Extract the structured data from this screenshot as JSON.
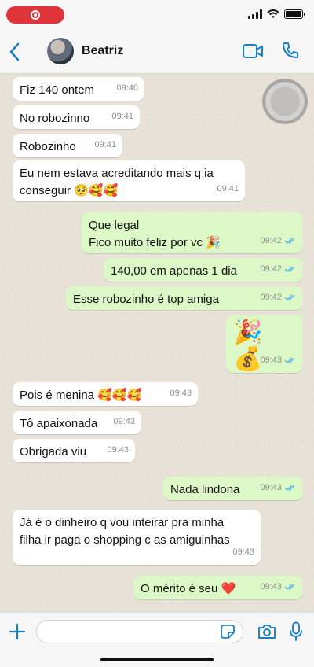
{
  "status_bar": {
    "recording_icon": "screen-recording-icon",
    "icons": [
      "signal-icon",
      "wifi-icon",
      "battery-icon"
    ]
  },
  "header": {
    "back_icon": "chevron-left-icon",
    "contact_name": "Beatriz",
    "video_icon": "video-call-icon",
    "call_icon": "phone-icon"
  },
  "messages": [
    {
      "dir": "in",
      "text": "Fiz 140 ontem",
      "time": "09:40"
    },
    {
      "dir": "in",
      "text": "No robozinno",
      "time": "09:41"
    },
    {
      "dir": "in",
      "text": "Robozinho",
      "time": "09:41"
    },
    {
      "dir": "in",
      "text": "Eu nem estava acreditando mais q ia\nconseguir 🥺🥰🥰",
      "time": "09:41"
    },
    {
      "dir": "out",
      "text": "Que legal\nFico muito feliz por vc 🎉",
      "time": "09:42"
    },
    {
      "dir": "out",
      "text": "140,00 em apenas 1 dia",
      "time": "09:42"
    },
    {
      "dir": "out",
      "text": "Esse robozinho é top amiga",
      "time": "09:42"
    },
    {
      "dir": "out",
      "text": "🎉 💰",
      "time": "09:43"
    },
    {
      "dir": "in",
      "text": "Pois é menina 🥰🥰🥰",
      "time": "09:43"
    },
    {
      "dir": "in",
      "text": "Tô apaixonada",
      "time": "09:43"
    },
    {
      "dir": "in",
      "text": "Obrigada viu",
      "time": "09:43"
    },
    {
      "dir": "out",
      "text": "Nada lindona",
      "time": "09:43"
    },
    {
      "dir": "in",
      "text": "Já é o dinheiro q vou inteirar pra minha\nfilha ir paga o shopping c as amiguinhas",
      "time": "09:43"
    },
    {
      "dir": "out",
      "text": "O mérito é seu ❤️",
      "time": "09:43"
    }
  ],
  "input_bar": {
    "plus_icon": "plus-icon",
    "message_value": "",
    "sticker_icon": "sticker-icon",
    "camera_icon": "camera-icon",
    "mic_icon": "microphone-icon"
  },
  "colors": {
    "incoming_bubble": "#ffffff",
    "outgoing_bubble": "#dcf8c6",
    "accent": "#1b7fc4",
    "read_ticks": "#4fb6ec"
  }
}
